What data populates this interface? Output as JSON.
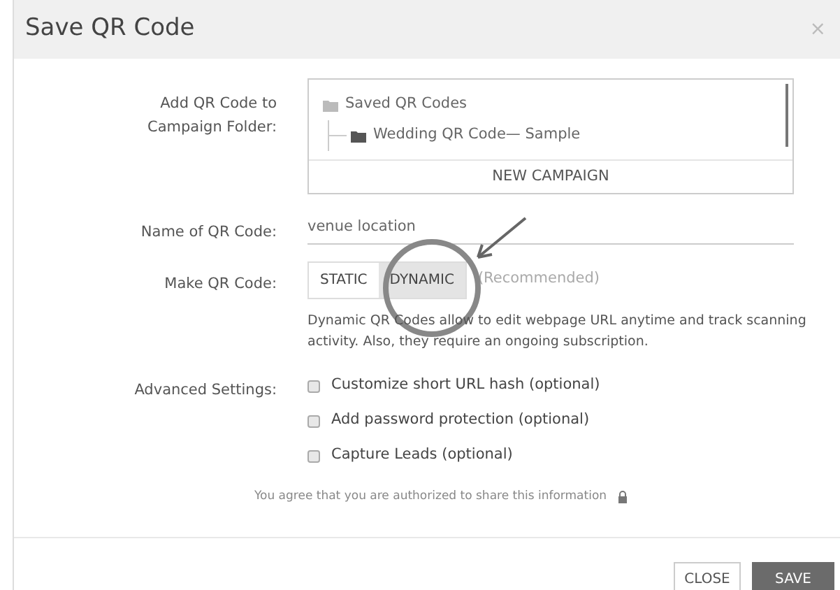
{
  "window": {
    "title": "Save QR Code",
    "close": "×"
  },
  "folder": {
    "label": "Add QR Code to Campaign Folder:",
    "tree": [
      {
        "label": "Saved QR Codes",
        "children": [
          {
            "label": "Wedding QR Code— Sample"
          }
        ]
      }
    ],
    "new_campaign": "NEW CAMPAIGN"
  },
  "name": {
    "label": "Name of QR Code:",
    "value": "venue location"
  },
  "make": {
    "label": "Make QR Code:",
    "options": [
      {
        "label": "STATIC",
        "selected": false
      },
      {
        "label": "DYNAMIC",
        "selected": true
      }
    ],
    "note": "(Recommended)",
    "description": "Dynamic QR Codes allow to edit webpage URL anytime and track scanning activity. Also, they require an ongoing subscription."
  },
  "advanced": {
    "label": "Advanced Settings:",
    "options": [
      {
        "label": "Customize short URL hash (optional)",
        "checked": false
      },
      {
        "label": "Add password protection (optional)",
        "checked": false
      },
      {
        "label": "Capture Leads (optional)",
        "checked": false
      }
    ]
  },
  "agreement": "You agree that you are authorized to share this information",
  "buttons": [
    {
      "label": "CLOSE",
      "kind": "secondary"
    },
    {
      "label": "SAVE",
      "kind": "primary"
    }
  ]
}
